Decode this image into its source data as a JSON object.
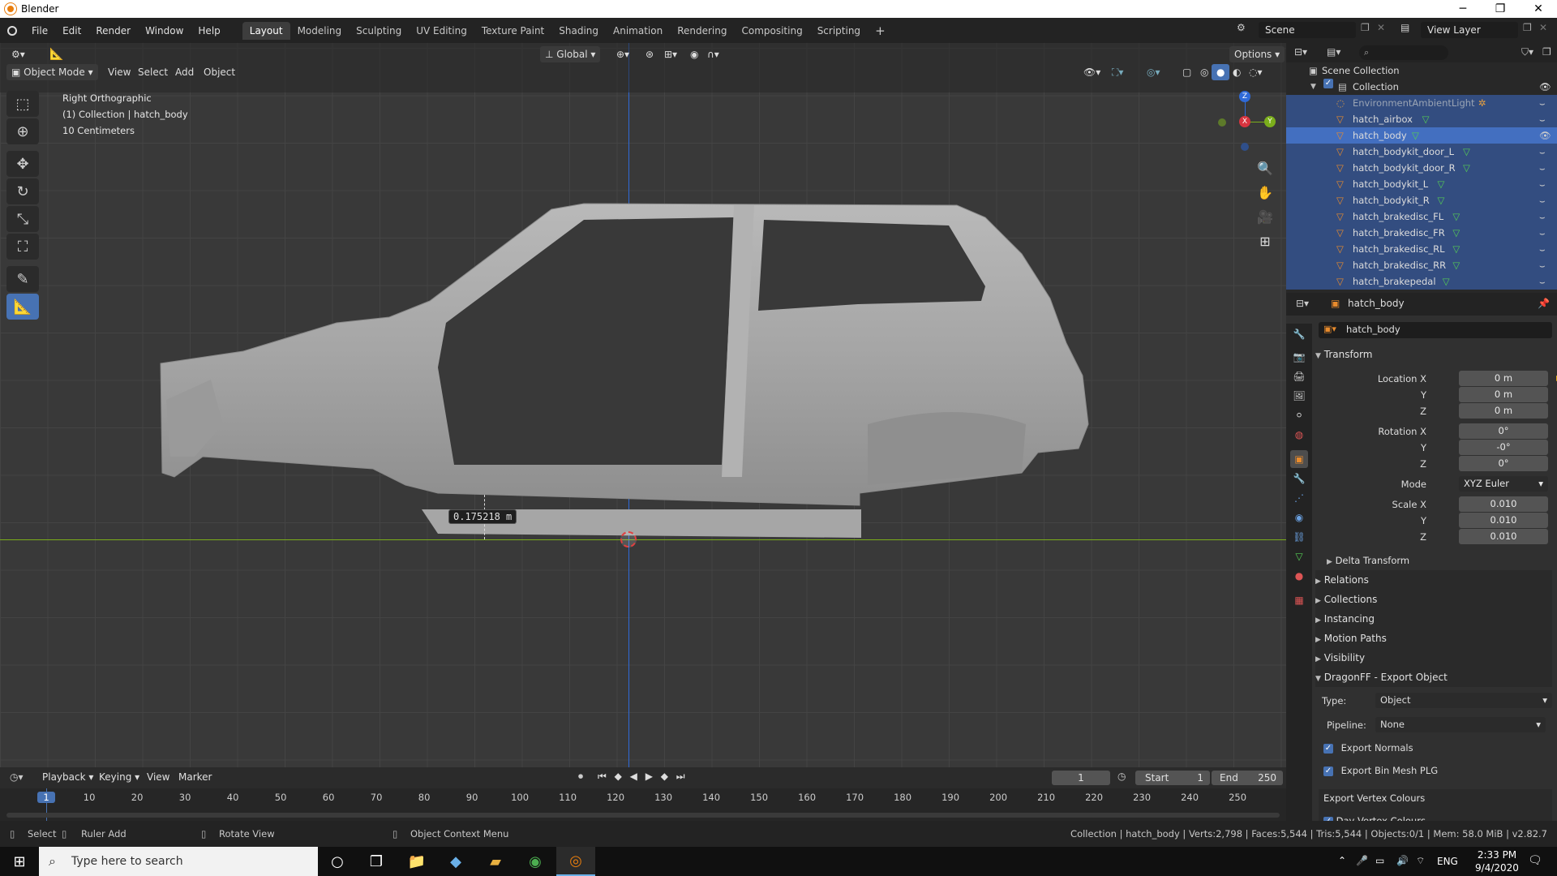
{
  "window": {
    "title": "Blender",
    "minimize": "─",
    "maximize": "❐",
    "close": "✕"
  },
  "menu": {
    "items": [
      "File",
      "Edit",
      "Render",
      "Window",
      "Help"
    ]
  },
  "workspaces": {
    "tabs": [
      "Layout",
      "Modeling",
      "Sculpting",
      "UV Editing",
      "Texture Paint",
      "Shading",
      "Animation",
      "Rendering",
      "Compositing",
      "Scripting"
    ],
    "active": "Layout",
    "add": "+"
  },
  "scene": {
    "scene_name": "Scene",
    "view_layer": "View Layer"
  },
  "viewport": {
    "mode": "Object Mode",
    "header_menus": [
      "View",
      "Select",
      "Add",
      "Object"
    ],
    "orientation": "Global",
    "options_label": "Options",
    "info_lines": [
      "Right Orthographic",
      "(1) Collection | hatch_body",
      "10 Centimeters"
    ],
    "ruler_value": "0.175218 m",
    "gizmo_labels": {
      "z": "Z",
      "x": "X",
      "y": "Y"
    },
    "icons": [
      "select-box-icon",
      "cursor-icon",
      "move-icon",
      "rotate-icon",
      "scale-icon",
      "transform-icon",
      "annotate-icon",
      "measure-icon"
    ]
  },
  "outliner": {
    "root": "Scene Collection",
    "collection": "Collection",
    "items": [
      {
        "name": "EnvironmentAmbientLight",
        "type": "light",
        "state": "sel"
      },
      {
        "name": "hatch_airbox",
        "type": "mesh",
        "state": "sel"
      },
      {
        "name": "hatch_body",
        "type": "mesh",
        "state": "active"
      },
      {
        "name": "hatch_bodykit_door_L",
        "type": "mesh",
        "state": "sel"
      },
      {
        "name": "hatch_bodykit_door_R",
        "type": "mesh",
        "state": "sel"
      },
      {
        "name": "hatch_bodykit_L",
        "type": "mesh",
        "state": "sel"
      },
      {
        "name": "hatch_bodykit_R",
        "type": "mesh",
        "state": "sel"
      },
      {
        "name": "hatch_brakedisc_FL",
        "type": "mesh",
        "state": "sel"
      },
      {
        "name": "hatch_brakedisc_FR",
        "type": "mesh",
        "state": "sel"
      },
      {
        "name": "hatch_brakedisc_RL",
        "type": "mesh",
        "state": "sel"
      },
      {
        "name": "hatch_brakedisc_RR",
        "type": "mesh",
        "state": "sel"
      },
      {
        "name": "hatch_brakepedal",
        "type": "mesh",
        "state": "sel"
      }
    ]
  },
  "properties": {
    "object_name": "hatch_body",
    "name_field": "hatch_body",
    "transform_label": "Transform",
    "location": {
      "label_x": "Location X",
      "x": "0 m",
      "y": "0 m",
      "z": "0 m"
    },
    "rotation": {
      "label_x": "Rotation X",
      "x": "0°",
      "y": "-0°",
      "z": "0°"
    },
    "mode_label": "Mode",
    "mode_value": "XYZ Euler",
    "scale": {
      "label_x": "Scale X",
      "x": "0.010",
      "y": "0.010",
      "z": "0.010"
    },
    "axis_labels": {
      "y": "Y",
      "z": "Z"
    },
    "delta_transform": "Delta Transform",
    "sections": [
      "Relations",
      "Collections",
      "Instancing",
      "Motion Paths",
      "Visibility"
    ],
    "dragonff": {
      "title": "DragonFF - Export Object",
      "type_label": "Type:",
      "type_value": "Object",
      "pipeline_label": "Pipeline:",
      "pipeline_value": "None",
      "export_normals": "Export Normals",
      "export_bin_mesh": "Export Bin Mesh PLG",
      "export_vertex_colours": "Export Vertex Colours",
      "day_vertex_colours": "Day Vertex Colours"
    }
  },
  "timeline": {
    "menus": [
      "Playback",
      "Keying",
      "View",
      "Marker"
    ],
    "current_frame": "1",
    "start_label": "Start",
    "start": "1",
    "end_label": "End",
    "end": "250",
    "ticks": [
      "1",
      "10",
      "20",
      "30",
      "40",
      "50",
      "60",
      "70",
      "80",
      "90",
      "100",
      "110",
      "120",
      "130",
      "140",
      "150",
      "160",
      "170",
      "180",
      "190",
      "200",
      "210",
      "220",
      "230",
      "240",
      "250"
    ]
  },
  "statusbar": {
    "select": "Select",
    "ruler_add": "Ruler Add",
    "rotate_view": "Rotate View",
    "context_menu": "Object Context Menu",
    "stats": "Collection | hatch_body | Verts:2,798 | Faces:5,544 | Tris:5,544 | Objects:0/1 | Mem: 58.0 MiB | v2.82.7"
  },
  "taskbar": {
    "search_placeholder": "Type here to search",
    "lang": "ENG",
    "time": "2:33 PM",
    "date": "9/4/2020"
  },
  "colors": {
    "accent": "#4772b3",
    "x_axis": "#d8343f",
    "y_axis": "#7bae1b",
    "z_axis": "#2f6ad8",
    "selection": "#334d80"
  }
}
